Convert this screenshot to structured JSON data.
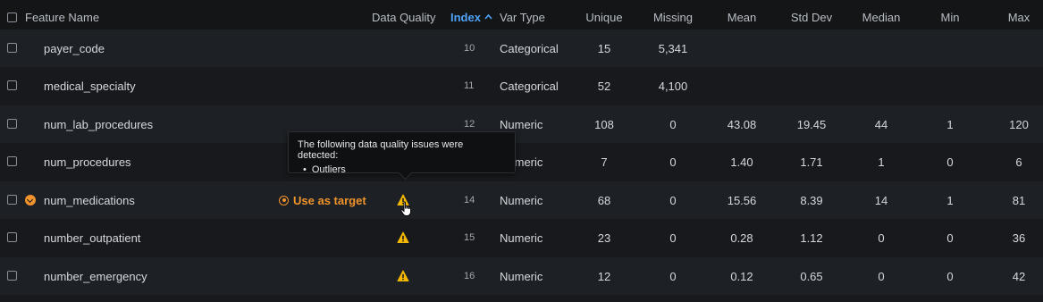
{
  "header": {
    "feature_name": "Feature Name",
    "data_quality": "Data Quality",
    "index": "Index",
    "var_type": "Var Type",
    "unique": "Unique",
    "missing": "Missing",
    "mean": "Mean",
    "std_dev": "Std Dev",
    "median": "Median",
    "min": "Min",
    "max": "Max"
  },
  "rows": [
    {
      "name": "payer_code",
      "index": "10",
      "var_type": "Categorical",
      "unique": "15",
      "missing": "5,341",
      "mean": "",
      "std_dev": "",
      "median": "",
      "min": "",
      "max": ""
    },
    {
      "name": "medical_specialty",
      "index": "11",
      "var_type": "Categorical",
      "unique": "52",
      "missing": "4,100",
      "mean": "",
      "std_dev": "",
      "median": "",
      "min": "",
      "max": ""
    },
    {
      "name": "num_lab_procedures",
      "index": "12",
      "var_type": "Numeric",
      "unique": "108",
      "missing": "0",
      "mean": "43.08",
      "std_dev": "19.45",
      "median": "44",
      "min": "1",
      "max": "120"
    },
    {
      "name": "num_procedures",
      "index": "13",
      "var_type": "Numeric",
      "unique": "7",
      "missing": "0",
      "mean": "1.40",
      "std_dev": "1.71",
      "median": "1",
      "min": "0",
      "max": "6"
    },
    {
      "name": "num_medications",
      "index": "14",
      "var_type": "Numeric",
      "unique": "68",
      "missing": "0",
      "mean": "15.56",
      "std_dev": "8.39",
      "median": "14",
      "min": "1",
      "max": "81"
    },
    {
      "name": "number_outpatient",
      "index": "15",
      "var_type": "Numeric",
      "unique": "23",
      "missing": "0",
      "mean": "0.28",
      "std_dev": "1.12",
      "median": "0",
      "min": "0",
      "max": "36"
    },
    {
      "name": "number_emergency",
      "index": "16",
      "var_type": "Numeric",
      "unique": "12",
      "missing": "0",
      "mean": "0.12",
      "std_dev": "0.65",
      "median": "0",
      "min": "0",
      "max": "42"
    }
  ],
  "hovered_row": {
    "use_as_target": "Use as target"
  },
  "tooltip": {
    "title": "The following data quality issues were detected:",
    "items": [
      "Outliers"
    ]
  },
  "colors": {
    "accent_orange": "#f0932b",
    "warning_yellow": "#f5b800",
    "sort_blue": "#4fa3f7"
  }
}
